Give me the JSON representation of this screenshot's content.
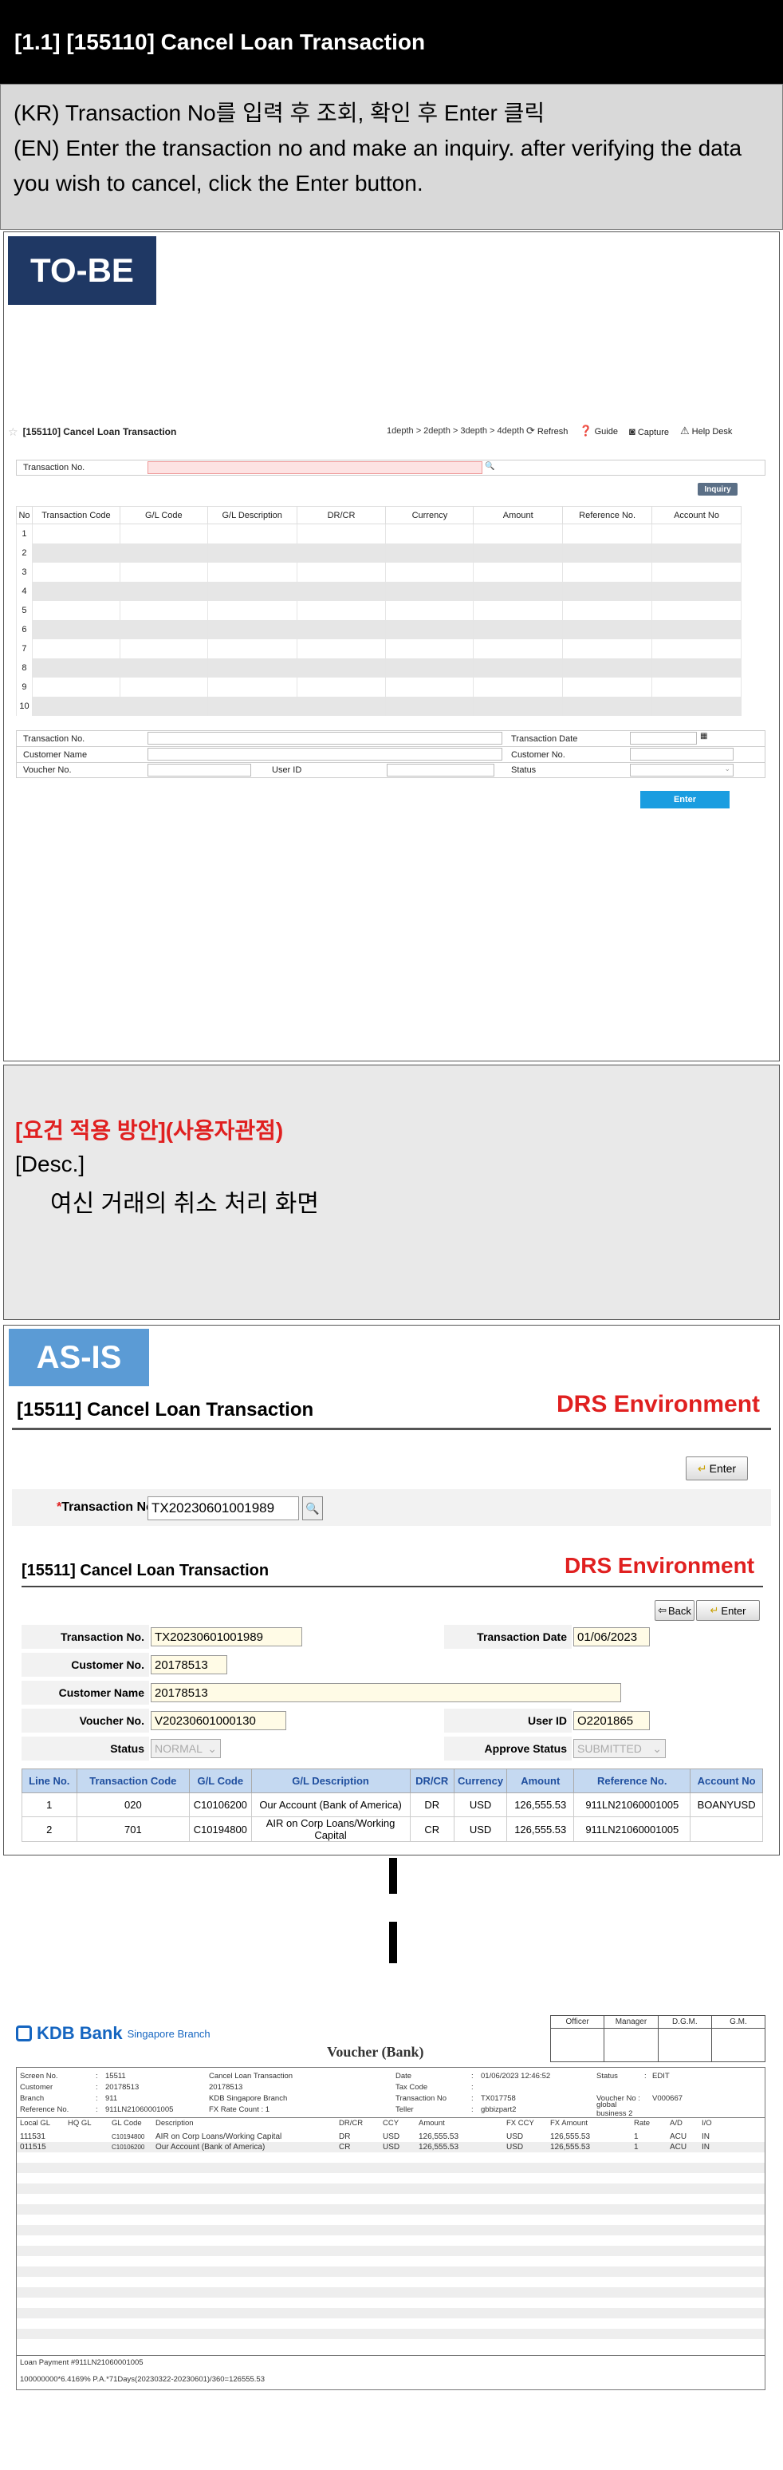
{
  "header": {
    "title": "[1.1] [155110] Cancel Loan Transaction",
    "desc_kr": "(KR) Transaction No를 입력 후 조회, 확인 후 Enter 클릭",
    "desc_en": "(EN) Enter the transaction no and make an inquiry. after verifying the data you wish to cancel, click the Enter button."
  },
  "tobe": {
    "badge": "TO-BE",
    "title": "[155110] Cancel Loan Transaction",
    "breadcrumb": "1depth > 2depth > 3depth > 4depth",
    "tools": [
      "Refresh",
      "Guide",
      "Capture",
      "Help Desk"
    ],
    "txn_label": "Transaction No.",
    "inquiry": "Inquiry",
    "grid_headers": [
      "No",
      "Transaction Code",
      "G/L Code",
      "G/L Description",
      "DR/CR",
      "Currency",
      "Amount",
      "Reference No.",
      "Account No"
    ],
    "rows": [
      "1",
      "2",
      "3",
      "4",
      "5",
      "6",
      "7",
      "8",
      "9",
      "10"
    ],
    "form": {
      "txn_no": "Transaction No.",
      "txn_date": "Transaction Date",
      "cust_name": "Customer Name",
      "cust_no": "Customer No.",
      "voucher_no": "Voucher No.",
      "user_id": "User ID",
      "status": "Status"
    },
    "enter": "Enter"
  },
  "requirement": {
    "title": "[요건 적용 방안](사용자관점)",
    "desc_label": "[Desc.]",
    "desc_text": "여신 거래의 취소 처리 화면"
  },
  "asis": {
    "badge": "AS-IS",
    "screen1_title": "[15511] Cancel Loan Transaction",
    "env": "DRS Environment",
    "enter": "Enter",
    "back": "Back",
    "txn_label": "Transaction No.",
    "txn_value": "TX20230601001989",
    "screen2_title": "[15511] Cancel Loan Transaction",
    "fields": {
      "txn_no_label": "Transaction No.",
      "txn_no": "TX20230601001989",
      "txn_date_label": "Transaction Date",
      "txn_date": "01/06/2023",
      "cust_no_label": "Customer No.",
      "cust_no": "20178513",
      "cust_name_label": "Customer Name",
      "cust_name": "20178513",
      "voucher_label": "Voucher No.",
      "voucher": "V20230601000130",
      "user_label": "User ID",
      "user": "O2201865",
      "status_label": "Status",
      "status": "NORMAL",
      "approve_label": "Approve Status",
      "approve": "SUBMITTED"
    },
    "table_headers": [
      "Line No.",
      "Transaction Code",
      "G/L Code",
      "G/L Description",
      "DR/CR",
      "Currency",
      "Amount",
      "Reference No.",
      "Account No"
    ],
    "table_rows": [
      [
        "1",
        "020",
        "C10106200",
        "Our Account (Bank of America)",
        "DR",
        "USD",
        "126,555.53",
        "911LN21060001005",
        "BOANYUSD"
      ],
      [
        "2",
        "701",
        "C10194800",
        "AIR on Corp Loans/Working Capital",
        "CR",
        "USD",
        "126,555.53",
        "911LN21060001005",
        ""
      ]
    ]
  },
  "voucher": {
    "logo": "KDB Bank",
    "logo_sub": "Singapore Branch",
    "sign": [
      "Officer",
      "Manager",
      "D.G.M.",
      "G.M."
    ],
    "title": "Voucher (Bank)",
    "info_left": [
      [
        "Screen No.",
        ":",
        "15511",
        "Cancel Loan Transaction"
      ],
      [
        "Customer",
        ":",
        "20178513",
        "20178513"
      ],
      [
        "Branch",
        ":",
        "911",
        "KDB Singapore Branch"
      ],
      [
        "Reference No.",
        ":",
        "911LN21060001005",
        "FX Rate Count :   1"
      ]
    ],
    "info_right": [
      [
        "Date",
        ":",
        "01/06/2023   12:46:52",
        "Status",
        ":",
        "EDIT"
      ],
      [
        "Tax Code",
        ":",
        "",
        "",
        "",
        ""
      ],
      [
        "Transaction No",
        ":",
        "TX017758",
        "Voucher No :",
        "",
        "V000667"
      ],
      [
        "Teller",
        ":",
        "gbbizpart2",
        "global business 2",
        "",
        ""
      ]
    ],
    "line_headers": [
      "Local GL",
      "HQ GL",
      "GL Code",
      "Description",
      "DR/CR",
      "CCY",
      "Amount",
      "FX CCY",
      "FX Amount",
      "Rate",
      "A/D",
      "I/O"
    ],
    "lines": [
      [
        "111531",
        "",
        "C10194800",
        "AIR on Corp Loans/Working Capital",
        "DR",
        "USD",
        "126,555.53",
        "USD",
        "126,555.53",
        "1",
        "ACU",
        "IN"
      ],
      [
        "011515",
        "",
        "C10106200",
        "Our Account (Bank of America)",
        "CR",
        "USD",
        "126,555.53",
        "USD",
        "126,555.53",
        "1",
        "ACU",
        "IN"
      ]
    ],
    "footer1": "Loan Payment #911LN21060001005",
    "footer2": "100000000*6.4169% P.A.*71Days(20230322-20230601)/360=126555.53"
  }
}
